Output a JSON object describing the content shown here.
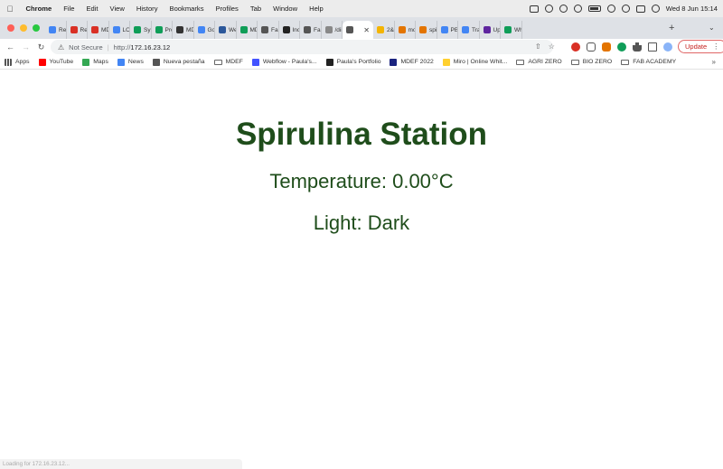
{
  "menubar": {
    "app": "Chrome",
    "items": [
      "File",
      "Edit",
      "View",
      "History",
      "Bookmarks",
      "Profiles",
      "Tab",
      "Window",
      "Help"
    ],
    "clock": "Wed 8 Jun  15:14"
  },
  "tabs": [
    {
      "label": "Re",
      "color": "#4285f4"
    },
    {
      "label": "Re",
      "color": "#d93025"
    },
    {
      "label": "MD",
      "color": "#d93025"
    },
    {
      "label": "LO",
      "color": "#4285f4"
    },
    {
      "label": "Sy",
      "color": "#0f9d58"
    },
    {
      "label": "Pro",
      "color": "#0f9d58"
    },
    {
      "label": "MD",
      "color": "#333333"
    },
    {
      "label": "Go",
      "color": "#4285f4"
    },
    {
      "label": "We",
      "color": "#2b579a"
    },
    {
      "label": "MD",
      "color": "#0f9d58"
    },
    {
      "label": "Fab",
      "color": "#555555"
    },
    {
      "label": "Inci",
      "color": "#222222"
    },
    {
      "label": "Fab",
      "color": "#555555"
    },
    {
      "label": "/dii",
      "color": "#888888"
    },
    {
      "label": "",
      "color": "#555555",
      "active": true
    },
    {
      "label": "2&",
      "color": "#f4b400"
    },
    {
      "label": "mo",
      "color": "#e37400"
    },
    {
      "label": "spi",
      "color": "#e37400"
    },
    {
      "label": "PB",
      "color": "#4285f4"
    },
    {
      "label": "Tra",
      "color": "#4285f4"
    },
    {
      "label": "Up",
      "color": "#5f259f"
    },
    {
      "label": "Wh",
      "color": "#0f9d58"
    }
  ],
  "toolbar": {
    "security": "Not Secure",
    "url_proto": "http://",
    "url_host": "172.16.23.12",
    "update_label": "Update"
  },
  "bookmarks": [
    {
      "label": "Apps",
      "type": "grid"
    },
    {
      "label": "YouTube",
      "type": "icon",
      "color": "#ff0000"
    },
    {
      "label": "Maps",
      "type": "icon",
      "color": "#34a853"
    },
    {
      "label": "News",
      "type": "icon",
      "color": "#4285f4"
    },
    {
      "label": "Nueva pestaña",
      "type": "icon",
      "color": "#555555"
    },
    {
      "label": "MDEF",
      "type": "folder"
    },
    {
      "label": "Webflow - Paula's...",
      "type": "icon",
      "color": "#4353ff"
    },
    {
      "label": "Paula's Portfolio",
      "type": "icon",
      "color": "#222222"
    },
    {
      "label": "MDEF 2022",
      "type": "icon",
      "color": "#1a237e"
    },
    {
      "label": "Miro | Online Whit...",
      "type": "icon",
      "color": "#ffd02f"
    },
    {
      "label": "AGRI ZERO",
      "type": "folder"
    },
    {
      "label": "BIO ZERO",
      "type": "folder"
    },
    {
      "label": "FAB ACADEMY",
      "type": "folder"
    }
  ],
  "page": {
    "title": "Spirulina Station",
    "temperature": "Temperature: 0.00°C",
    "light": "Light: Dark",
    "title_color": "#1f4d1b"
  },
  "status": "Loading for 172.16.23.12..."
}
